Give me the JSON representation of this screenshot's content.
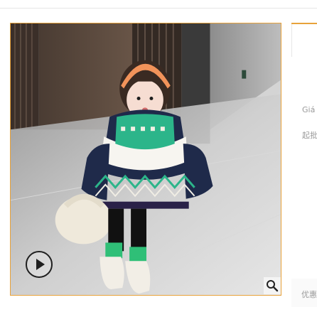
{
  "product_panel": {
    "price_label": "Giá",
    "moq_label": "起批",
    "discount_label": "优惠"
  },
  "gallery": {
    "play_icon": "play-icon",
    "zoom_icon": "zoom-icon"
  },
  "colors": {
    "accent": "#e8a23a"
  }
}
